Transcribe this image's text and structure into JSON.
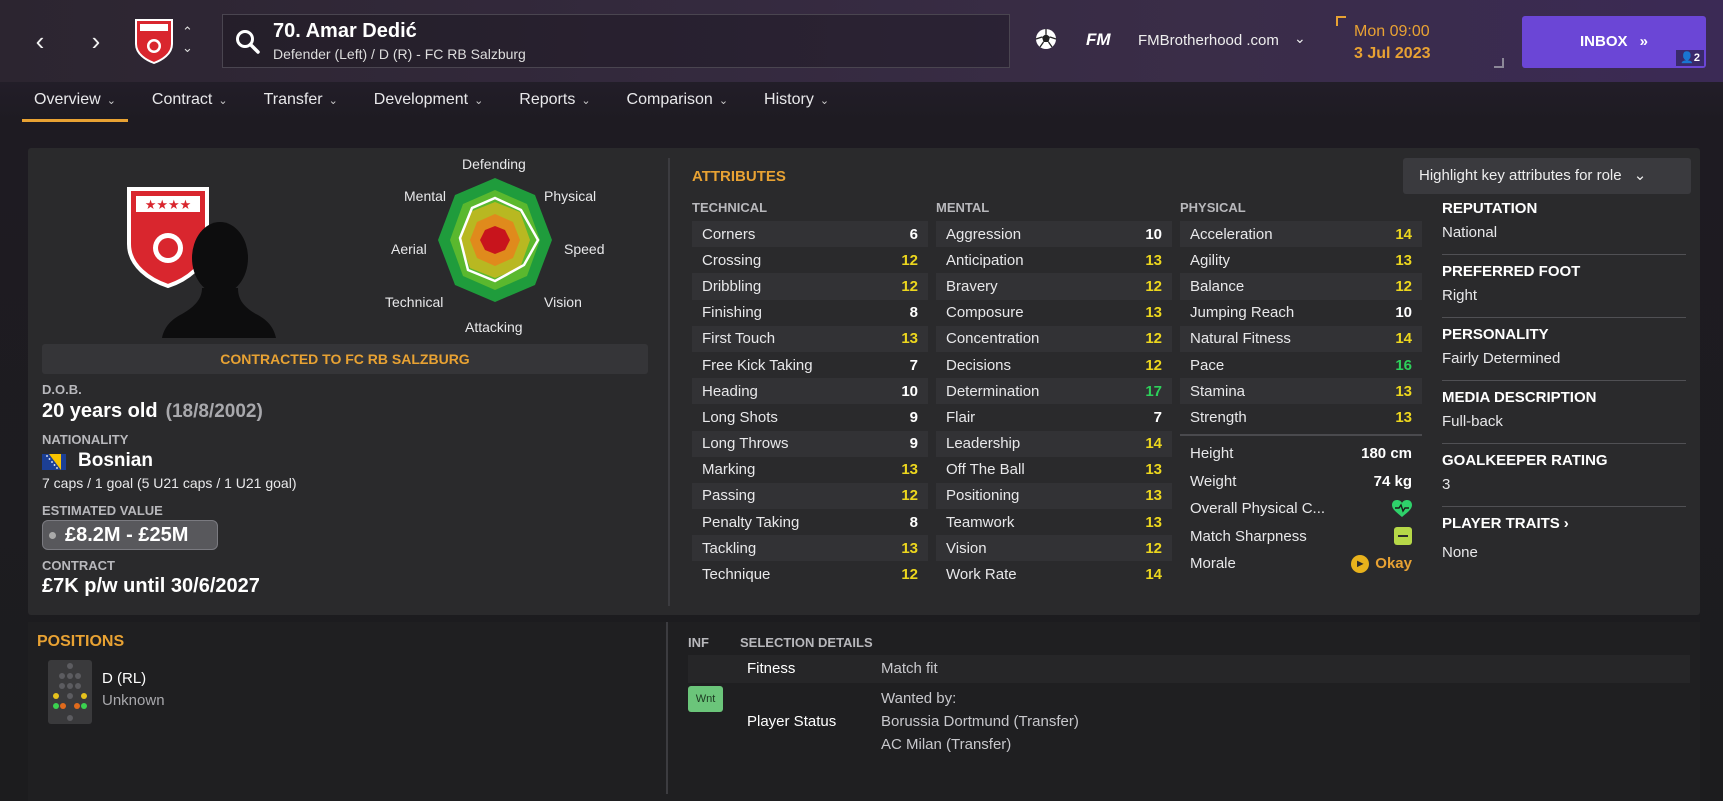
{
  "header": {
    "player_title": "70. Amar Dedić",
    "player_subtitle": "Defender (Left) / D (R) - FC RB Salzburg",
    "fm_logo": "FM",
    "site": "FMBrotherhood .com",
    "day_time": "Mon 09:00",
    "date": "3 Jul 2023",
    "inbox_label": "INBOX",
    "inbox_count": "2",
    "icons": [
      "back-arrow-icon",
      "forward-arrow-icon",
      "club-crest-icon",
      "up-down-icon",
      "search-icon",
      "football-icon",
      "chevron-down-icon",
      "double-chevron-icon",
      "person-icon"
    ]
  },
  "tabs": [
    {
      "label": "Overview"
    },
    {
      "label": "Contract"
    },
    {
      "label": "Transfer"
    },
    {
      "label": "Development"
    },
    {
      "label": "Reports"
    },
    {
      "label": "Comparison"
    },
    {
      "label": "History"
    }
  ],
  "radar": {
    "labels": {
      "defending": "Defending",
      "physical": "Physical",
      "speed": "Speed",
      "vision": "Vision",
      "attacking": "Attacking",
      "technical": "Technical",
      "aerial": "Aerial",
      "mental": "Mental"
    }
  },
  "profile": {
    "contract_banner": "CONTRACTED TO FC RB SALZBURG",
    "dob_label": "D.O.B.",
    "age": "20 years old",
    "dob": "(18/8/2002)",
    "nationality_label": "NATIONALITY",
    "nationality": "Bosnian",
    "caps": "7 caps / 1 goal (5 U21 caps / 1 U21 goal)",
    "value_label": "ESTIMATED VALUE",
    "value": "£8.2M - £25M",
    "contract_label": "CONTRACT",
    "contract": "£7K p/w until 30/6/2027"
  },
  "attributes": {
    "title": "ATTRIBUTES",
    "highlight_button": "Highlight key attributes for role",
    "technical_head": "TECHNICAL",
    "mental_head": "MENTAL",
    "physical_head": "PHYSICAL",
    "technical": [
      {
        "name": "Corners",
        "value": "6",
        "tone": "white"
      },
      {
        "name": "Crossing",
        "value": "12",
        "tone": "yellow"
      },
      {
        "name": "Dribbling",
        "value": "12",
        "tone": "yellow"
      },
      {
        "name": "Finishing",
        "value": "8",
        "tone": "white"
      },
      {
        "name": "First Touch",
        "value": "13",
        "tone": "yellow"
      },
      {
        "name": "Free Kick Taking",
        "value": "7",
        "tone": "white"
      },
      {
        "name": "Heading",
        "value": "10",
        "tone": "white"
      },
      {
        "name": "Long Shots",
        "value": "9",
        "tone": "white"
      },
      {
        "name": "Long Throws",
        "value": "9",
        "tone": "white"
      },
      {
        "name": "Marking",
        "value": "13",
        "tone": "yellow"
      },
      {
        "name": "Passing",
        "value": "12",
        "tone": "yellow"
      },
      {
        "name": "Penalty Taking",
        "value": "8",
        "tone": "white"
      },
      {
        "name": "Tackling",
        "value": "13",
        "tone": "yellow"
      },
      {
        "name": "Technique",
        "value": "12",
        "tone": "yellow"
      }
    ],
    "mental": [
      {
        "name": "Aggression",
        "value": "10",
        "tone": "white"
      },
      {
        "name": "Anticipation",
        "value": "13",
        "tone": "yellow"
      },
      {
        "name": "Bravery",
        "value": "12",
        "tone": "yellow"
      },
      {
        "name": "Composure",
        "value": "13",
        "tone": "yellow"
      },
      {
        "name": "Concentration",
        "value": "12",
        "tone": "yellow"
      },
      {
        "name": "Decisions",
        "value": "12",
        "tone": "yellow"
      },
      {
        "name": "Determination",
        "value": "17",
        "tone": "green"
      },
      {
        "name": "Flair",
        "value": "7",
        "tone": "white"
      },
      {
        "name": "Leadership",
        "value": "14",
        "tone": "yellow"
      },
      {
        "name": "Off The Ball",
        "value": "13",
        "tone": "yellow"
      },
      {
        "name": "Positioning",
        "value": "13",
        "tone": "yellow"
      },
      {
        "name": "Teamwork",
        "value": "13",
        "tone": "yellow"
      },
      {
        "name": "Vision",
        "value": "12",
        "tone": "yellow"
      },
      {
        "name": "Work Rate",
        "value": "14",
        "tone": "yellow"
      }
    ],
    "physical": [
      {
        "name": "Acceleration",
        "value": "14",
        "tone": "yellow"
      },
      {
        "name": "Agility",
        "value": "13",
        "tone": "yellow"
      },
      {
        "name": "Balance",
        "value": "12",
        "tone": "yellow"
      },
      {
        "name": "Jumping Reach",
        "value": "10",
        "tone": "white"
      },
      {
        "name": "Natural Fitness",
        "value": "14",
        "tone": "yellow"
      },
      {
        "name": "Pace",
        "value": "16",
        "tone": "green"
      },
      {
        "name": "Stamina",
        "value": "13",
        "tone": "yellow"
      },
      {
        "name": "Strength",
        "value": "13",
        "tone": "yellow"
      }
    ],
    "physical_extra": {
      "height_label": "Height",
      "height": "180 cm",
      "weight_label": "Weight",
      "weight": "74 kg",
      "condition_label": "Overall Physical C...",
      "sharpness_label": "Match Sharpness",
      "morale_label": "Morale",
      "morale": "Okay"
    }
  },
  "info": {
    "reputation_label": "REPUTATION",
    "reputation": "National",
    "foot_label": "PREFERRED FOOT",
    "foot": "Right",
    "personality_label": "PERSONALITY",
    "personality": "Fairly Determined",
    "media_label": "MEDIA DESCRIPTION",
    "media": "Full-back",
    "gk_label": "GOALKEEPER RATING",
    "gk": "3",
    "traits_label": "PLAYER TRAITS",
    "traits": "None"
  },
  "positions": {
    "title": "POSITIONS",
    "position": "D (RL)",
    "familiarity": "Unknown"
  },
  "selection": {
    "inf_head": "INF",
    "head": "SELECTION DETAILS",
    "fitness_label": "Fitness",
    "fitness": "Match fit",
    "status_badge": "Wnt",
    "status_label": "Player Status",
    "wanted_label": "Wanted by:",
    "wanted_1": "Borussia Dortmund (Transfer)",
    "wanted_2": "AC Milan (Transfer)"
  },
  "colors": {
    "accent": "#e8a233",
    "inbox": "#6b46d6",
    "attr_yellow": "#ecd61e",
    "attr_green": "#2dd05a",
    "crest_red": "#d9262e"
  }
}
